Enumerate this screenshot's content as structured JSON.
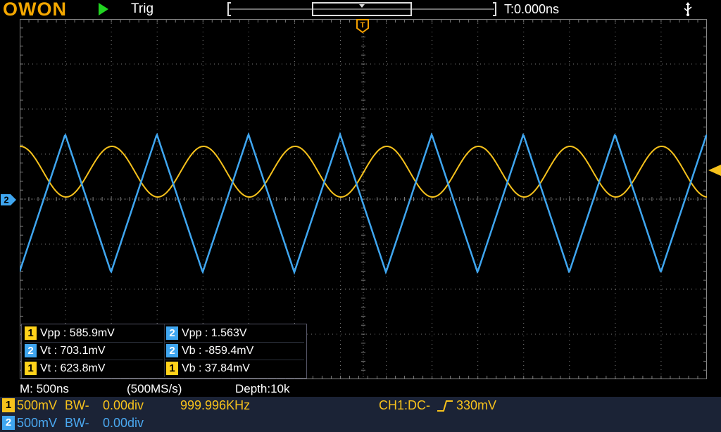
{
  "top": {
    "logo": "OWON",
    "trigger_status": "Trig",
    "time_offset": "T:0.000ns"
  },
  "colors": {
    "ch1": "#f7c21c",
    "ch2": "#3fa6f0",
    "trigger_marker": "#f5a000",
    "grid": "#7a7a7a",
    "bottom_bar": "#1b2336"
  },
  "icons": [
    "play-icon",
    "usb-icon",
    "trigger-position-icon",
    "ch2-ground-marker-icon",
    "trigger-level-icon"
  ],
  "measurements": [
    {
      "channel": "1",
      "label": "Vpp : 585.9mV"
    },
    {
      "channel": "2",
      "label": "Vpp : 1.563V"
    },
    {
      "channel": "2",
      "label": "Vt : 703.1mV"
    },
    {
      "channel": "2",
      "label": "Vb : -859.4mV"
    },
    {
      "channel": "1",
      "label": "Vt : 623.8mV"
    },
    {
      "channel": "1",
      "label": "Vb : 37.84mV"
    }
  ],
  "status": {
    "timebase": "M: 500ns",
    "sample_rate": "(500MS/s)",
    "depth": "Depth:10k"
  },
  "channels": [
    {
      "badge": "1",
      "scale": "500mV",
      "bw": "BW-",
      "offset": "0.00div",
      "frequency": "999.996KHz"
    },
    {
      "badge": "2",
      "scale": "500mV",
      "bw": "BW-",
      "offset": "0.00div"
    }
  ],
  "trigger": {
    "source": "CH1:DC-",
    "level": "330mV"
  }
}
